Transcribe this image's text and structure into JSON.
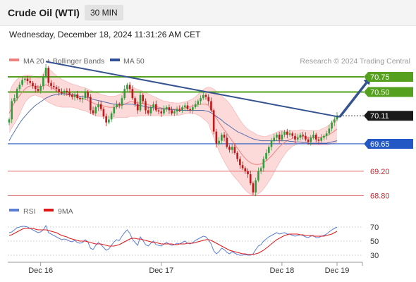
{
  "header": {
    "title": "Crude Oil (WTI)",
    "timeframe": "30 MIN",
    "datetime": "Wednesday, December 18, 2024 11:31:26 AM CET"
  },
  "colors": {
    "bollinger": "#f08080",
    "bollinger_fill": "#fbd3d3",
    "ma50": "#2f4f9a",
    "bull": "#2e9e3a",
    "bear": "#c01818",
    "resistance": "#55a01e",
    "support_blue": "#2358c4",
    "support_red": "#e07070",
    "trend": "#34538f",
    "rsi": "#5b7fd6",
    "rsi_ma": "#e01818"
  },
  "chart_data": [
    {
      "type": "candlestick",
      "legend": [
        {
          "label": "MA 20 + Bollinger Bands",
          "color": "#f08080"
        },
        {
          "label": "MA 50",
          "color": "#2f4f9a"
        }
      ],
      "credit": "Research © 2024 Trading Central",
      "x_ticks": [
        {
          "label": "Dec 16",
          "index": 12
        },
        {
          "label": "Dec 17",
          "index": 58
        },
        {
          "label": "Dec 18",
          "index": 104
        },
        {
          "label": "Dec 19",
          "index": 125
        }
      ],
      "ylim": [
        68.7,
        70.9
      ],
      "current_price": 70.11,
      "levels": [
        {
          "value": 70.75,
          "label": "70.75",
          "kind": "resistance"
        },
        {
          "value": 70.5,
          "label": "70.50",
          "kind": "resistance"
        },
        {
          "value": 69.65,
          "label": "69.65",
          "kind": "support_blue"
        },
        {
          "value": 69.2,
          "label": "69.20",
          "kind": "support_red"
        },
        {
          "value": 68.8,
          "label": "68.80",
          "kind": "support_red"
        }
      ],
      "trendline": [
        {
          "index": 14,
          "value": 71.0
        },
        {
          "index": 126,
          "value": 70.09
        }
      ],
      "arrow": {
        "from": {
          "index": 126,
          "value": 70.09
        },
        "to": {
          "index": 138,
          "value": 70.75
        }
      },
      "closes": [
        70.05,
        70.35,
        70.4,
        70.55,
        70.62,
        70.7,
        70.72,
        70.68,
        70.65,
        70.6,
        70.55,
        70.52,
        70.6,
        70.75,
        70.9,
        70.65,
        70.6,
        70.58,
        70.55,
        70.5,
        70.48,
        70.52,
        70.5,
        70.45,
        70.42,
        70.46,
        70.4,
        70.38,
        70.4,
        70.5,
        70.42,
        70.2,
        70.15,
        70.25,
        70.3,
        70.22,
        70.1,
        70.0,
        70.05,
        70.15,
        70.25,
        70.3,
        70.28,
        70.4,
        70.55,
        70.62,
        70.55,
        70.4,
        70.3,
        70.2,
        70.45,
        70.35,
        70.2,
        70.15,
        70.25,
        70.3,
        70.2,
        70.18,
        70.15,
        70.22,
        70.25,
        70.2,
        70.15,
        70.18,
        70.22,
        70.2,
        70.25,
        70.28,
        70.22,
        70.2,
        70.25,
        70.3,
        70.35,
        70.4,
        70.45,
        70.42,
        70.35,
        70.2,
        69.85,
        69.65,
        69.7,
        69.8,
        69.75,
        69.6,
        69.55,
        69.6,
        69.5,
        69.4,
        69.3,
        69.25,
        69.2,
        69.15,
        69.0,
        68.85,
        69.05,
        69.2,
        69.25,
        69.4,
        69.5,
        69.6,
        69.7,
        69.75,
        69.8,
        69.72,
        69.8,
        69.85,
        69.8,
        69.82,
        69.78,
        69.72,
        69.75,
        69.8,
        69.78,
        69.72,
        69.68,
        69.75,
        69.8,
        69.72,
        69.7,
        69.75,
        69.78,
        69.82,
        69.9,
        70.0,
        70.05,
        70.11
      ],
      "ma20": [
        70.15,
        70.25,
        70.32,
        70.38,
        70.44,
        70.5,
        70.55,
        70.58,
        70.6,
        70.6,
        70.6,
        70.58,
        70.58,
        70.6,
        70.62,
        70.6,
        70.58,
        70.55,
        70.52,
        70.5,
        70.48,
        70.47,
        70.46,
        70.45,
        70.44,
        70.43,
        70.42,
        70.4,
        70.39,
        70.38,
        70.36,
        70.34,
        70.32,
        70.3,
        70.29,
        70.28,
        70.27,
        70.26,
        70.25,
        70.25,
        70.25,
        70.26,
        70.27,
        70.28,
        70.3,
        70.32,
        70.34,
        70.34,
        70.33,
        70.32,
        70.32,
        70.31,
        70.3,
        70.29,
        70.28,
        70.27,
        70.26,
        70.25,
        70.24,
        70.23,
        70.23,
        70.22,
        70.22,
        70.22,
        70.22,
        70.22,
        70.23,
        70.24,
        70.25,
        70.26,
        70.27,
        70.28,
        70.29,
        70.3,
        70.3,
        70.3,
        70.28,
        70.22,
        70.15,
        70.07,
        70.0,
        69.94,
        69.88,
        69.82,
        69.76,
        69.7,
        69.64,
        69.58,
        69.52,
        69.46,
        69.41,
        69.37,
        69.34,
        69.32,
        69.31,
        69.31,
        69.32,
        69.34,
        69.37,
        69.41,
        69.45,
        69.5,
        69.55,
        69.6,
        69.64,
        69.67,
        69.7,
        69.72,
        69.74,
        69.75,
        69.76,
        69.77,
        69.77,
        69.76,
        69.75,
        69.75,
        69.75,
        69.75,
        69.75,
        69.76,
        69.77,
        69.78,
        69.8,
        69.83,
        69.86,
        69.89
      ],
      "ma50": [
        69.7,
        69.78,
        69.85,
        69.92,
        69.99,
        70.05,
        70.1,
        70.15,
        70.2,
        70.24,
        70.28,
        70.31,
        70.34,
        70.37,
        70.4,
        70.42,
        70.44,
        70.45,
        70.46,
        70.47,
        70.47,
        70.47,
        70.47,
        70.46,
        70.46,
        70.45,
        70.44,
        70.43,
        70.42,
        70.42,
        70.41,
        70.4,
        70.38,
        70.37,
        70.36,
        70.35,
        70.34,
        70.33,
        70.32,
        70.31,
        70.3,
        70.3,
        70.3,
        70.3,
        70.3,
        70.3,
        70.3,
        70.3,
        70.29,
        70.28,
        70.28,
        70.27,
        70.26,
        70.25,
        70.25,
        70.24,
        70.24,
        70.23,
        70.23,
        70.22,
        70.22,
        70.22,
        70.21,
        70.21,
        70.2,
        70.2,
        70.2,
        70.2,
        70.2,
        70.2,
        70.2,
        70.2,
        70.2,
        70.2,
        70.2,
        70.19,
        70.18,
        70.16,
        70.13,
        70.1,
        70.07,
        70.04,
        70.0,
        69.97,
        69.94,
        69.91,
        69.88,
        69.85,
        69.83,
        69.81,
        69.79,
        69.77,
        69.75,
        69.73,
        69.72,
        69.71,
        69.7,
        69.7,
        69.7,
        69.7,
        69.7,
        69.7,
        69.7,
        69.7,
        69.7,
        69.7,
        69.7,
        69.69,
        69.69,
        69.68,
        69.68,
        69.68,
        69.67,
        69.67,
        69.66,
        69.66,
        69.66,
        69.66,
        69.66,
        69.66,
        69.66,
        69.66,
        69.67,
        69.68,
        69.69,
        69.7
      ],
      "band_width": [
        0.32,
        0.34,
        0.34,
        0.33,
        0.3,
        0.26,
        0.22,
        0.2,
        0.18,
        0.16,
        0.15,
        0.15,
        0.16,
        0.2,
        0.26,
        0.27,
        0.27,
        0.26,
        0.25,
        0.24,
        0.23,
        0.22,
        0.21,
        0.2,
        0.19,
        0.19,
        0.19,
        0.19,
        0.19,
        0.19,
        0.19,
        0.19,
        0.19,
        0.19,
        0.19,
        0.18,
        0.18,
        0.18,
        0.18,
        0.18,
        0.18,
        0.18,
        0.19,
        0.2,
        0.22,
        0.24,
        0.24,
        0.24,
        0.23,
        0.22,
        0.21,
        0.2,
        0.19,
        0.18,
        0.17,
        0.16,
        0.15,
        0.14,
        0.13,
        0.12,
        0.12,
        0.11,
        0.11,
        0.1,
        0.1,
        0.1,
        0.1,
        0.1,
        0.1,
        0.11,
        0.12,
        0.14,
        0.17,
        0.2,
        0.24,
        0.27,
        0.3,
        0.35,
        0.4,
        0.44,
        0.47,
        0.5,
        0.52,
        0.54,
        0.55,
        0.55,
        0.54,
        0.53,
        0.52,
        0.52,
        0.52,
        0.52,
        0.52,
        0.52,
        0.5,
        0.48,
        0.46,
        0.43,
        0.4,
        0.38,
        0.35,
        0.32,
        0.29,
        0.26,
        0.23,
        0.2,
        0.17,
        0.15,
        0.13,
        0.12,
        0.11,
        0.11,
        0.11,
        0.11,
        0.11,
        0.12,
        0.12,
        0.12,
        0.12,
        0.13,
        0.14,
        0.15,
        0.16,
        0.18,
        0.2,
        0.22
      ]
    },
    {
      "type": "line",
      "legend": [
        {
          "label": "RSI",
          "color": "#5b7fd6"
        },
        {
          "label": "9MA",
          "color": "#e01818"
        }
      ],
      "ylim": [
        20,
        80
      ],
      "y_ticks": [
        70,
        50,
        30
      ],
      "rsi": [
        62,
        63,
        66,
        69,
        70,
        71,
        71,
        70,
        68,
        66,
        64,
        62,
        63,
        66,
        72,
        62,
        60,
        58,
        56,
        54,
        52,
        53,
        52,
        50,
        49,
        51,
        48,
        47,
        48,
        52,
        49,
        40,
        38,
        44,
        48,
        45,
        41,
        37,
        39,
        44,
        49,
        52,
        51,
        57,
        62,
        66,
        61,
        53,
        48,
        44,
        56,
        51,
        45,
        43,
        47,
        50,
        45,
        44,
        43,
        46,
        48,
        46,
        44,
        45,
        47,
        46,
        48,
        50,
        47,
        46,
        48,
        51,
        53,
        55,
        57,
        56,
        52,
        46,
        36,
        32,
        35,
        40,
        38,
        34,
        32,
        35,
        33,
        31,
        30,
        30,
        31,
        30,
        30,
        32,
        38,
        43,
        45,
        50,
        53,
        56,
        58,
        60,
        62,
        60,
        61,
        62,
        60,
        60,
        58,
        57,
        58,
        59,
        58,
        56,
        55,
        57,
        58,
        55,
        55,
        57,
        58,
        60,
        63,
        66,
        68,
        70
      ],
      "ma9": [
        58,
        59,
        61,
        63,
        65,
        67,
        68,
        68,
        68,
        68,
        67,
        66,
        66,
        66,
        66,
        65,
        64,
        63,
        62,
        60,
        58,
        57,
        56,
        54,
        53,
        52,
        51,
        50,
        50,
        50,
        49,
        48,
        47,
        46,
        46,
        46,
        45,
        44,
        43,
        43,
        43,
        44,
        45,
        47,
        49,
        51,
        53,
        54,
        54,
        53,
        53,
        52,
        51,
        50,
        49,
        48,
        48,
        47,
        46,
        46,
        46,
        46,
        46,
        45,
        45,
        46,
        46,
        46,
        47,
        47,
        47,
        48,
        49,
        50,
        51,
        52,
        52,
        51,
        49,
        47,
        45,
        43,
        41,
        39,
        37,
        36,
        35,
        34,
        33,
        32,
        32,
        31,
        31,
        31,
        32,
        33,
        35,
        37,
        40,
        43,
        46,
        49,
        52,
        54,
        56,
        58,
        59,
        60,
        60,
        60,
        60,
        59,
        59,
        58,
        58,
        58,
        57,
        57,
        57,
        57,
        57,
        58,
        59,
        60,
        62,
        64
      ]
    }
  ]
}
